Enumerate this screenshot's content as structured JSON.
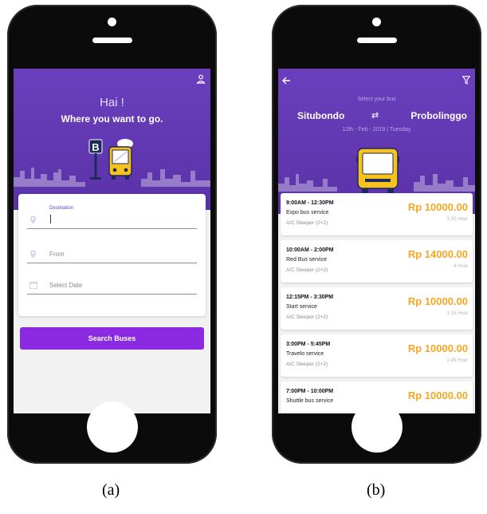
{
  "screen_a": {
    "greeting": "Hai !",
    "tagline": "Where you want to go.",
    "destination_label": "Destination",
    "from_placeholder": "From",
    "date_placeholder": "Select Date",
    "search_button": "Search Buses",
    "illustration_sign": "B"
  },
  "screen_b": {
    "select_label": "Select your bus",
    "from_city": "Situbondo",
    "to_city": "Probolinggo",
    "swap_symbol": "⇄",
    "date_line": "12th - Feb - 2019 | Tuesday",
    "buses": [
      {
        "time": "9:00AM - 12:30PM",
        "name": "Expo bus service",
        "type": "A/C Sleeper (2+2)",
        "price": "Rp 10000.00",
        "duration": "3.30 Hour"
      },
      {
        "time": "10:00AM - 2:00PM",
        "name": "Red Bus service",
        "type": "A/C Sleeper (2+2)",
        "price": "Rp 14000.00",
        "duration": "4 Hour"
      },
      {
        "time": "12:15PM - 3:30PM",
        "name": "Start service",
        "type": "A/C Sleeper (2+2)",
        "price": "Rp 10000.00",
        "duration": "3.15 Hour"
      },
      {
        "time": "3:00PM - 5:45PM",
        "name": "Travelo service",
        "type": "A/C Sleeper (2+2)",
        "price": "Rp 10000.00",
        "duration": "2.45 Hour"
      },
      {
        "time": "7:00PM - 10:00PM",
        "name": "Shuttle bus service",
        "type": "",
        "price": "Rp 10000.00",
        "duration": ""
      }
    ]
  },
  "captions": {
    "a": "(a)",
    "b": "(b)"
  },
  "colors": {
    "header_purple": "#5f36b0",
    "button_purple": "#8a2be2",
    "price_orange": "#f5a623",
    "bus_yellow": "#f7c21b"
  }
}
